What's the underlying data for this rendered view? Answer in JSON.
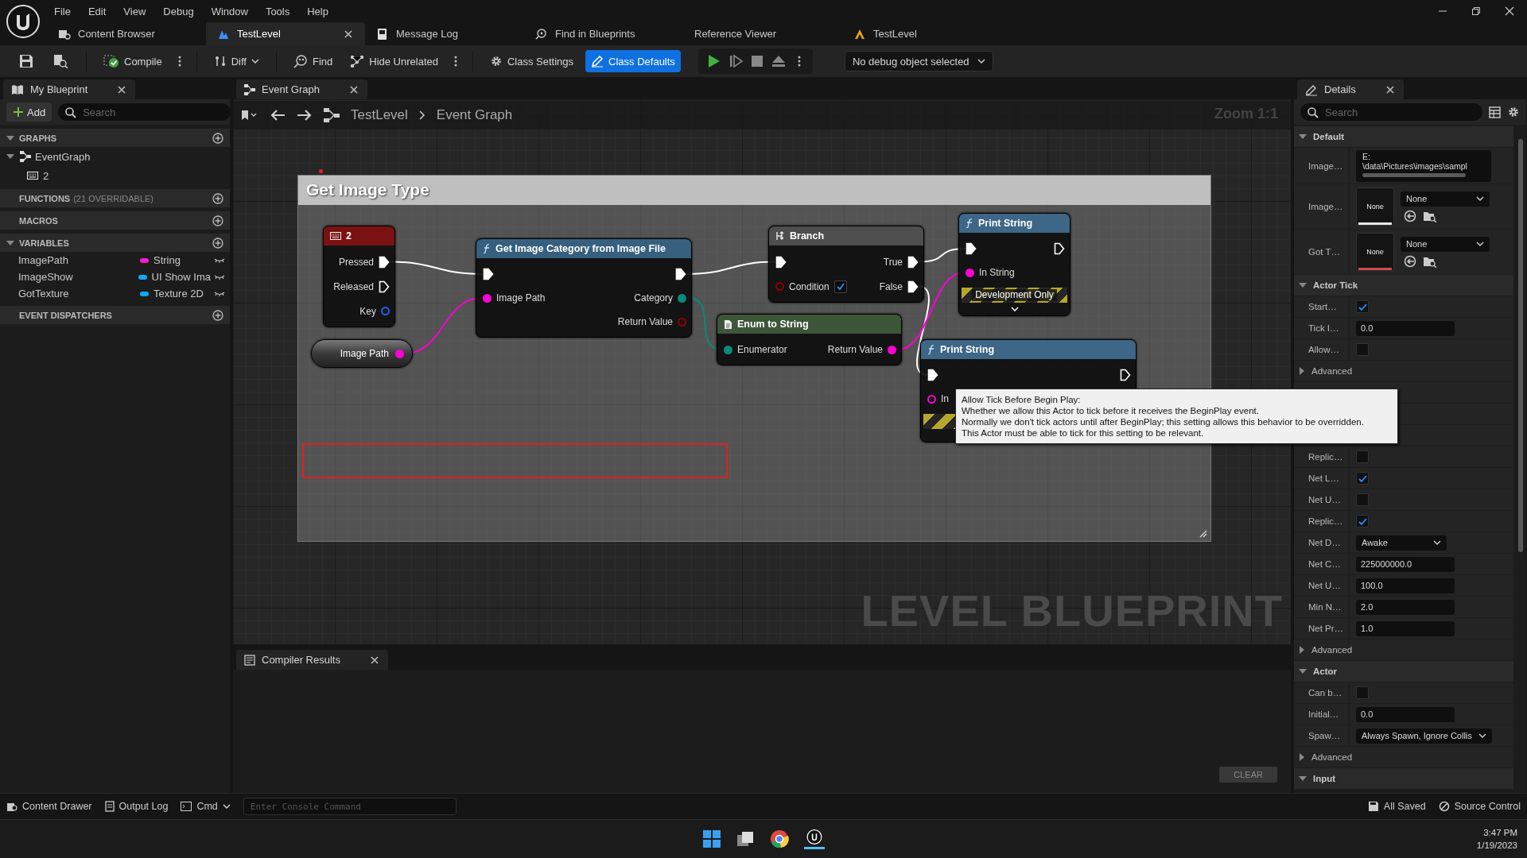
{
  "menu": [
    "File",
    "Edit",
    "View",
    "Debug",
    "Window",
    "Tools",
    "Help"
  ],
  "document_tabs": [
    {
      "kind": "content_browser",
      "label": "Content Browser",
      "selected": false,
      "closable": false
    },
    {
      "kind": "blueprint",
      "label": "TestLevel",
      "selected": true,
      "closable": true
    },
    {
      "kind": "log",
      "label": "Message Log",
      "selected": false,
      "closable": false
    },
    {
      "kind": "search",
      "label": "Find in Blueprints",
      "selected": false,
      "closable": false
    },
    {
      "kind": "plain",
      "label": "Reference Viewer",
      "selected": false,
      "closable": false
    },
    {
      "kind": "level",
      "label": "TestLevel",
      "selected": false,
      "closable": false
    }
  ],
  "toolbar": {
    "compile": "Compile",
    "diff": "Diff",
    "find": "Find",
    "hide_unrelated": "Hide Unrelated",
    "mode_buttons": [
      {
        "label": "Class Settings",
        "selected": false
      },
      {
        "label": "Class Defaults",
        "selected": true
      }
    ],
    "debug_object": "No debug object selected"
  },
  "my_blueprint": {
    "tab": "My Blueprint",
    "add": "Add",
    "search_placeholder": "Search",
    "sections": [
      {
        "title": "GRAPHS",
        "expanded": true,
        "graphs": [
          {
            "label": "EventGraph",
            "expanded": true,
            "children": [
              {
                "label": "2"
              }
            ]
          }
        ]
      },
      {
        "title": "FUNCTIONS",
        "note": "(21 OVERRIDABLE)",
        "expanded": false
      },
      {
        "title": "MACROS",
        "expanded": false
      },
      {
        "title": "VARIABLES",
        "expanded": true,
        "variables": [
          {
            "name": "ImagePath",
            "type": "String",
            "color": "#f01ad0"
          },
          {
            "name": "ImageShow",
            "type": "UI Show Ima",
            "color": "#12a8f0"
          },
          {
            "name": "GotTexture",
            "type": "Texture 2D",
            "color": "#12a8f0"
          }
        ]
      },
      {
        "title": "EVENT DISPATCHERS",
        "expanded": false
      }
    ]
  },
  "graph": {
    "tab": "Event Graph",
    "breadcrumb": [
      "TestLevel",
      "Event Graph"
    ],
    "zoom": "Zoom 1:1",
    "comment": "Get Image Type",
    "watermark_label": "LEVEL BLUEPRINT",
    "nodes": [
      {
        "kind": "event",
        "title": "2",
        "color": "#7a1212",
        "rows": [
          {
            "right": {
              "kind": "exec",
              "label": "Pressed",
              "linked": true
            }
          },
          {
            "right": {
              "kind": "exec",
              "label": "Released",
              "linked": false
            }
          },
          {
            "right": {
              "kind": "data",
              "label": "Key",
              "color": "#1f5ff0",
              "linked": false
            }
          }
        ]
      },
      {
        "kind": "variable",
        "title": "Image Path",
        "pin": {
          "kind": "data",
          "color": "#ff00d4",
          "linked": true
        }
      },
      {
        "kind": "function",
        "title": "Get Image Category from Image File",
        "color": "#36607e",
        "rows": [
          {
            "left": {
              "kind": "exec",
              "linked": true
            },
            "right": {
              "kind": "exec",
              "linked": true
            }
          },
          {
            "left": {
              "kind": "data",
              "label": "Image Path",
              "color": "#ff00d4",
              "linked": true
            },
            "right": {
              "kind": "data",
              "label": "Category",
              "color": "#0a8a78",
              "linked": true
            }
          },
          {
            "right": {
              "kind": "data",
              "label": "Return Value",
              "color": "#940000",
              "linked": false
            }
          }
        ]
      },
      {
        "kind": "branch",
        "title": "Branch",
        "color": "#4e4e4e",
        "rows": [
          {
            "left": {
              "kind": "exec",
              "linked": true
            },
            "right": {
              "kind": "exec",
              "label": "True",
              "linked": true
            }
          },
          {
            "left": {
              "kind": "bool",
              "label": "Condition",
              "color": "#940000",
              "linked": false,
              "checked": true
            },
            "right": {
              "kind": "exec",
              "label": "False",
              "linked": true
            }
          }
        ]
      },
      {
        "kind": "pure",
        "title": "Enum to String",
        "color": "#3d5639",
        "rows": [
          {
            "left": {
              "kind": "data",
              "label": "Enumerator",
              "color": "#0a8a78",
              "linked": true
            },
            "right": {
              "kind": "data",
              "label": "Return Value",
              "color": "#ff00d4",
              "linked": true
            }
          }
        ]
      },
      {
        "kind": "function",
        "title": "Print String",
        "color": "#3d6687",
        "development_only": true,
        "dev_label": "Development Only",
        "rows": [
          {
            "left": {
              "kind": "exec",
              "linked": true
            },
            "right": {
              "kind": "exec",
              "linked": false
            }
          },
          {
            "left": {
              "kind": "data",
              "label": "In String",
              "color": "#ff00d4",
              "linked": true
            }
          }
        ]
      },
      {
        "kind": "function",
        "title": "Print String",
        "color": "#3d6687",
        "development_only": true,
        "rows": [
          {
            "left": {
              "kind": "exec",
              "linked": true
            },
            "right": {
              "kind": "exec",
              "linked": false
            }
          },
          {
            "left": {
              "kind": "data",
              "label": "In",
              "color": "#ff00d4",
              "linked": false
            }
          }
        ]
      }
    ]
  },
  "tooltip": {
    "lines": [
      "Allow Tick Before Begin Play:",
      "Whether we allow this Actor to tick before it receives the BeginPlay event.",
      "Normally we don't tick actors until after BeginPlay; this setting allows this behavior to be overridden.",
      "This Actor must be able to tick for this setting to be relevant."
    ]
  },
  "compiler_results": {
    "tab": "Compiler Results",
    "clear": "CLEAR"
  },
  "details": {
    "tab": "Details",
    "search_placeholder": "Search",
    "rows": [
      {
        "kind": "section",
        "label": "Default",
        "expanded": true
      },
      {
        "kind": "path",
        "label": "Image…",
        "lines": [
          "E:",
          "\\data\\Pictures\\images\\sampl"
        ]
      },
      {
        "kind": "asset",
        "label": "Image…",
        "thumb": "None",
        "value": "None",
        "color": "#e8e8e8"
      },
      {
        "kind": "asset",
        "label": "Got T…",
        "thumb": "None",
        "value": "None",
        "color": "#d04848"
      },
      {
        "kind": "section",
        "label": "Actor Tick",
        "expanded": true
      },
      {
        "kind": "checkbox",
        "label": "Start…",
        "checked": true
      },
      {
        "kind": "number",
        "label": "Tick I…",
        "value": "0.0"
      },
      {
        "kind": "checkbox",
        "label": "Allow…",
        "checked": false
      },
      {
        "kind": "advanced",
        "label": "Advanced",
        "expanded": false
      },
      {
        "kind": "covered"
      },
      {
        "kind": "covered"
      },
      {
        "kind": "covered"
      },
      {
        "kind": "checkbox",
        "label": "Replic…",
        "checked": false
      },
      {
        "kind": "checkbox",
        "label": "Net L…",
        "checked": true
      },
      {
        "kind": "checkbox",
        "label": "Net U…",
        "checked": false
      },
      {
        "kind": "checkbox",
        "label": "Replic…",
        "checked": true
      },
      {
        "kind": "dropdown",
        "label": "Net D…",
        "value": "Awake"
      },
      {
        "kind": "number",
        "label": "Net C…",
        "value": "225000000.0"
      },
      {
        "kind": "number",
        "label": "Net U…",
        "value": "100.0"
      },
      {
        "kind": "number",
        "label": "Min N…",
        "value": "2.0"
      },
      {
        "kind": "number",
        "label": "Net Pr…",
        "value": "1.0"
      },
      {
        "kind": "advanced",
        "label": "Advanced",
        "expanded": false
      },
      {
        "kind": "section",
        "label": "Actor",
        "expanded": true
      },
      {
        "kind": "checkbox",
        "label": "Can b…",
        "checked": false
      },
      {
        "kind": "number",
        "label": "Initial…",
        "value": "0.0"
      },
      {
        "kind": "dropdown",
        "label": "Spaw…",
        "value": "Always Spawn, Ignore Collis"
      },
      {
        "kind": "advanced",
        "label": "Advanced",
        "expanded": false
      },
      {
        "kind": "section",
        "label": "Input",
        "expanded": true
      }
    ]
  },
  "status_bar": {
    "content_drawer": "Content Drawer",
    "output_log": "Output Log",
    "cmd": "Cmd",
    "console_placeholder": "Enter Console Command",
    "saved": "All Saved",
    "source_control": "Source Control"
  },
  "taskbar": {
    "time": "3:47 PM",
    "date": "1/19/2023"
  }
}
